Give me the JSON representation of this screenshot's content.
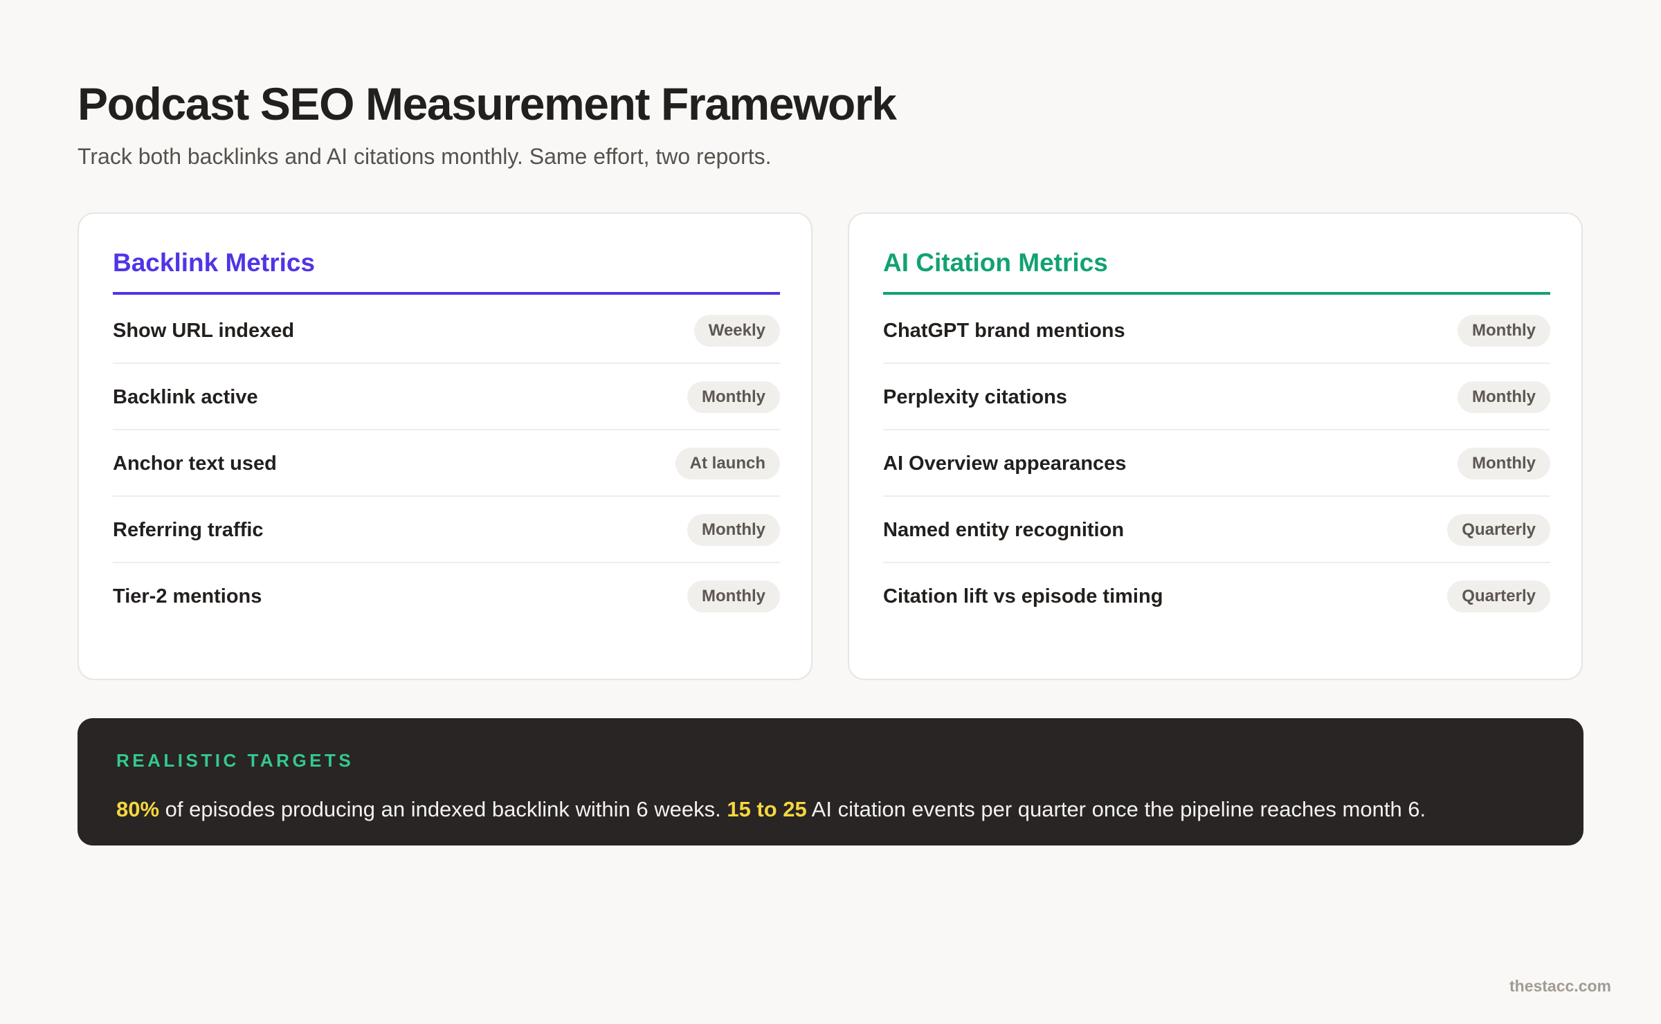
{
  "header": {
    "title": "Podcast SEO Measurement Framework",
    "subtitle": "Track both backlinks and AI citations monthly. Same effort, two reports."
  },
  "cards": [
    {
      "title": "Backlink Metrics",
      "accent_color": "#4f35e6",
      "rows": [
        {
          "label": "Show URL indexed",
          "frequency": "Weekly"
        },
        {
          "label": "Backlink active",
          "frequency": "Monthly"
        },
        {
          "label": "Anchor text used",
          "frequency": "At launch"
        },
        {
          "label": "Referring traffic",
          "frequency": "Monthly"
        },
        {
          "label": "Tier-2 mentions",
          "frequency": "Monthly"
        }
      ]
    },
    {
      "title": "AI Citation Metrics",
      "accent_color": "#12a272",
      "rows": [
        {
          "label": "ChatGPT brand mentions",
          "frequency": "Monthly"
        },
        {
          "label": "Perplexity citations",
          "frequency": "Monthly"
        },
        {
          "label": "AI Overview appearances",
          "frequency": "Monthly"
        },
        {
          "label": "Named entity recognition",
          "frequency": "Quarterly"
        },
        {
          "label": "Citation lift vs episode timing",
          "frequency": "Quarterly"
        }
      ]
    }
  ],
  "targets": {
    "label": "REALISTIC TARGETS",
    "highlight_1": "80%",
    "text_1": " of episodes producing an indexed backlink within 6 weeks. ",
    "highlight_2": "15 to 25",
    "text_2": " AI citation events per quarter once the pipeline reaches month 6."
  },
  "footer": {
    "site": "thestacc.com"
  },
  "colors": {
    "background": "#f9f8f6",
    "backlink_accent": "#4f35e6",
    "ai_accent": "#12a272",
    "targets_background": "#282524",
    "targets_label": "#34c98e",
    "highlight": "#f6d63f"
  }
}
